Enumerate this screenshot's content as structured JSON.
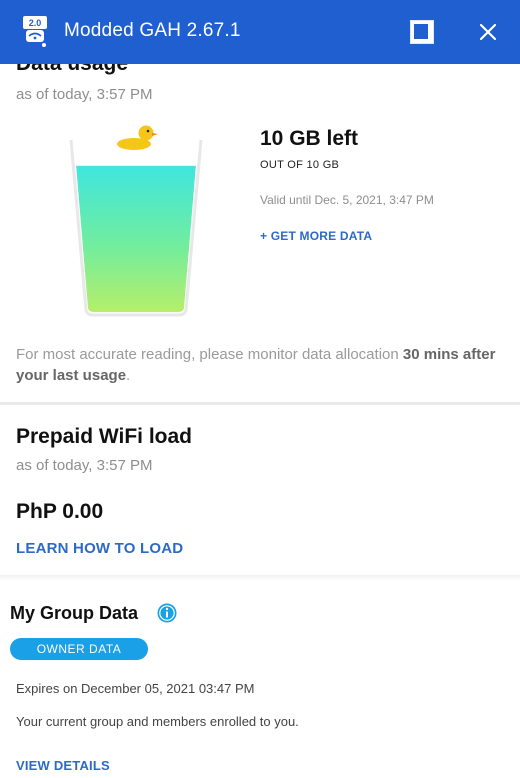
{
  "window": {
    "title": "Modded GAH 2.67.1",
    "app_icon_label": "2.0",
    "app_icon": "gah-app-icon",
    "restore_icon": "restore-window-icon",
    "close_icon": "close-icon",
    "accent_color": "#1f5fd0"
  },
  "data_usage": {
    "heading": "Data usage",
    "as_of": "as of today, 3:57 PM",
    "remaining": "10 GB left",
    "total": "OUT OF 10 GB",
    "valid_until": "Valid until Dec. 5, 2021, 3:47 PM",
    "get_more": "+ GET MORE DATA",
    "fill_fraction": 0.85,
    "note_prefix": "For most accurate reading, please monitor data allocation ",
    "note_bold": "30 mins after your last usage",
    "note_suffix": "."
  },
  "prepaid": {
    "heading": "Prepaid WiFi load",
    "as_of": "as of today, 3:57 PM",
    "balance": "PhP 0.00",
    "learn_link": "LEARN HOW TO LOAD"
  },
  "group_data": {
    "heading": "My Group Data",
    "info_icon": "info-icon",
    "badge": "OWNER DATA",
    "expires": "Expires on December 05, 2021 03:47 PM",
    "members_text": "Your current group and members enrolled to you.",
    "view_details": "VIEW DETAILS",
    "link_color": "#2d6ac8",
    "badge_color": "#1aa0e6"
  }
}
